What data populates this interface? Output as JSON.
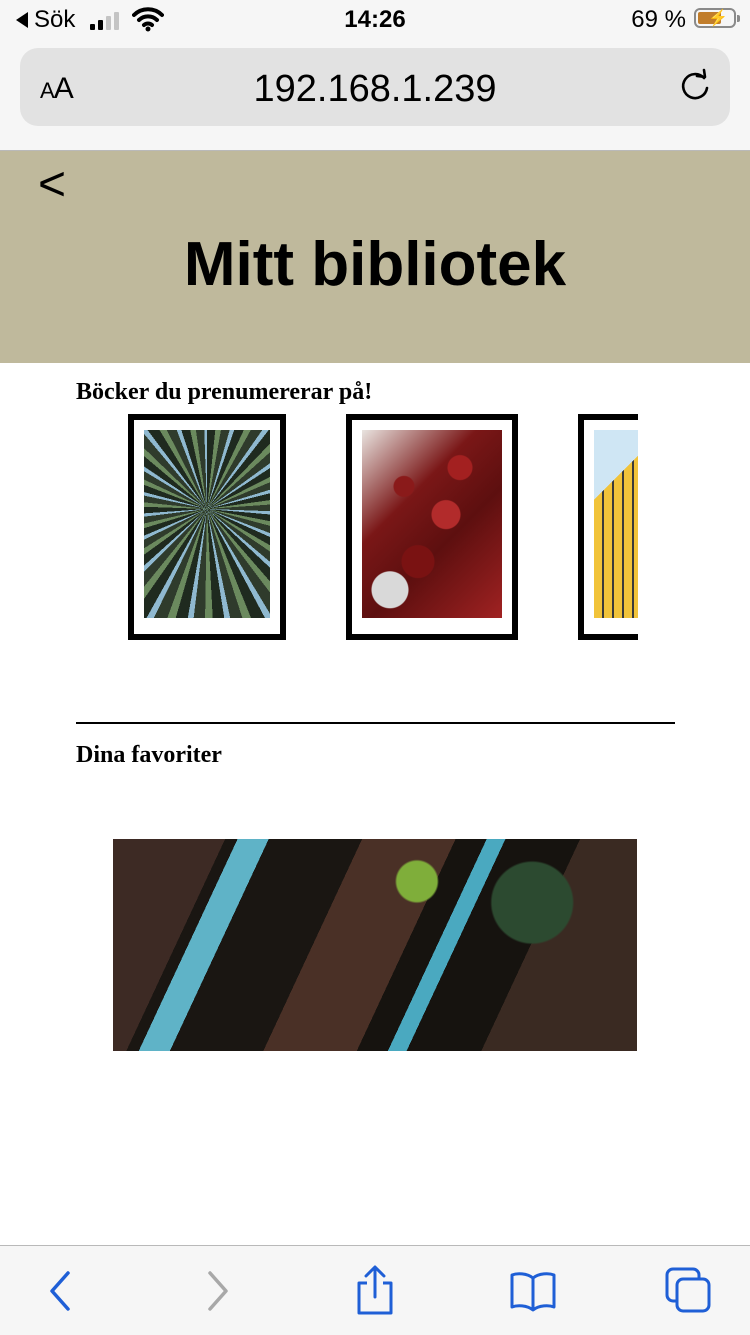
{
  "status_bar": {
    "back_app": "Sök",
    "time": "14:26",
    "battery_percent": "69 %",
    "battery_level": 0.69
  },
  "browser": {
    "text_size_label": "AA",
    "url": "192.168.1.239"
  },
  "header": {
    "back_label": "<",
    "title": "Mitt bibliotek",
    "background_color": "#bfb99c"
  },
  "subscriptions": {
    "heading": "Böcker du prenumererar på!",
    "books": [
      {
        "image": "forest-canopy"
      },
      {
        "image": "red-flowers"
      },
      {
        "image": "yellow-building"
      }
    ]
  },
  "favorites": {
    "heading": "Dina favoriter",
    "image": "tree-trunks"
  },
  "toolbar": {
    "accent_color": "#1f5fd6",
    "buttons": [
      "back-icon",
      "forward-icon",
      "share-icon",
      "bookmarks-icon",
      "tabs-icon"
    ]
  }
}
